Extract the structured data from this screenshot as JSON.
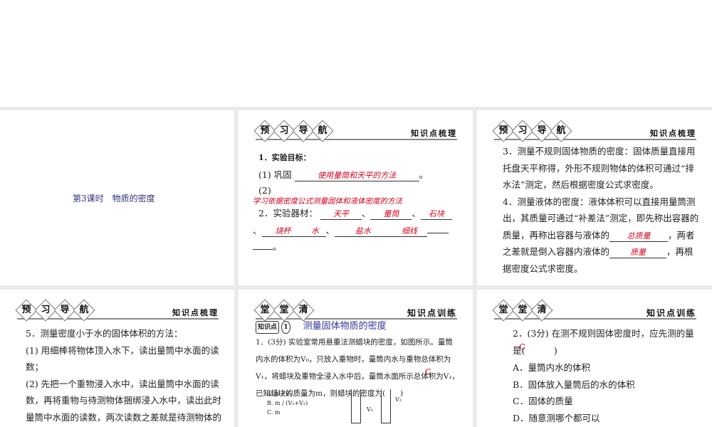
{
  "slide1": {
    "title": "第3课时　物质的密度"
  },
  "headers": {
    "preview_badge": [
      "预",
      "习",
      "导",
      "航"
    ],
    "preview_right": "知识点梳理",
    "class_badge": [
      "堂",
      "堂",
      "清"
    ],
    "class_right": "知识点训练"
  },
  "slide2": {
    "item1": "1．实验目标：",
    "p1_prefix": "(1) 巩固",
    "p1_answer": "使用量筒和天平的方法",
    "p1_suffix": "。",
    "p2_prefix": "(2)",
    "p2_answer": "学习依据密度公式测量固体和液体密度的方法",
    "item2": "2．实验器材：",
    "materials": [
      "天平",
      "量筒",
      "石块",
      "烧杯",
      "水",
      "盐水",
      "细线"
    ],
    "sep": "、",
    "end": "。"
  },
  "slide3": {
    "p3": "3．测量不规则固体物质的密度：固体质量直接用托盘天平称得，外形不规则物体的体积可通过“排水法”测定，然后根据密度公式求密度。",
    "p4a": "4．测量液体的密度：液体体积可以直接用量筒测出，其质量可通过“补差法”测定，即先称出容器的质量，再称出容器与液体的",
    "ans1": "总质量",
    "p4b": "，两者之差就是倒入容器内液体的",
    "ans2": "质量",
    "p4c": "，再根据密度公式求密度。"
  },
  "slide4": {
    "p5": "5．测量密度小于水的固体体积的方法：",
    "p5_1": "(1) 用细棒将物体顶入水下，读出量筒中水面的读数；",
    "p5_2": "(2) 先把一个重物浸入水中，读出量筒中水面的读数，再将重物与待测物体捆绑浸入水中，读出此时量筒中水面的读数，两次读数之差就是待测物体的"
  },
  "slide5": {
    "kp_label": "知识点",
    "kp_num": "1",
    "kp_title": "测量固体物质的密度",
    "q1": "1．(3分) 实验室常用悬重法测蜡块的密度，如图所示。量筒内水的体积为V₀，只放入重物时，量筒内水与重物总体积为V₁，将蜡块及重物全浸入水中后，量筒水面所示总体积为V₂，已知蜡块的质量为m，则蜡块的密度为(　　)",
    "answer": "C",
    "optA": "A. m / V₀",
    "optB": "B. m / (V₁+V₂)",
    "optC": "C. m",
    "v1": "V₁",
    "v2": "V₂"
  },
  "slide6": {
    "q2a": "2．(3分) 在测不规则固体密度时，应先测的量是(",
    "q2b": ")",
    "answer": "C",
    "options": [
      "A．量筒内水的体积",
      "B．固体放入量筒后的水的体积",
      "C．固体的质量",
      "D．随意测哪个都可以"
    ]
  }
}
